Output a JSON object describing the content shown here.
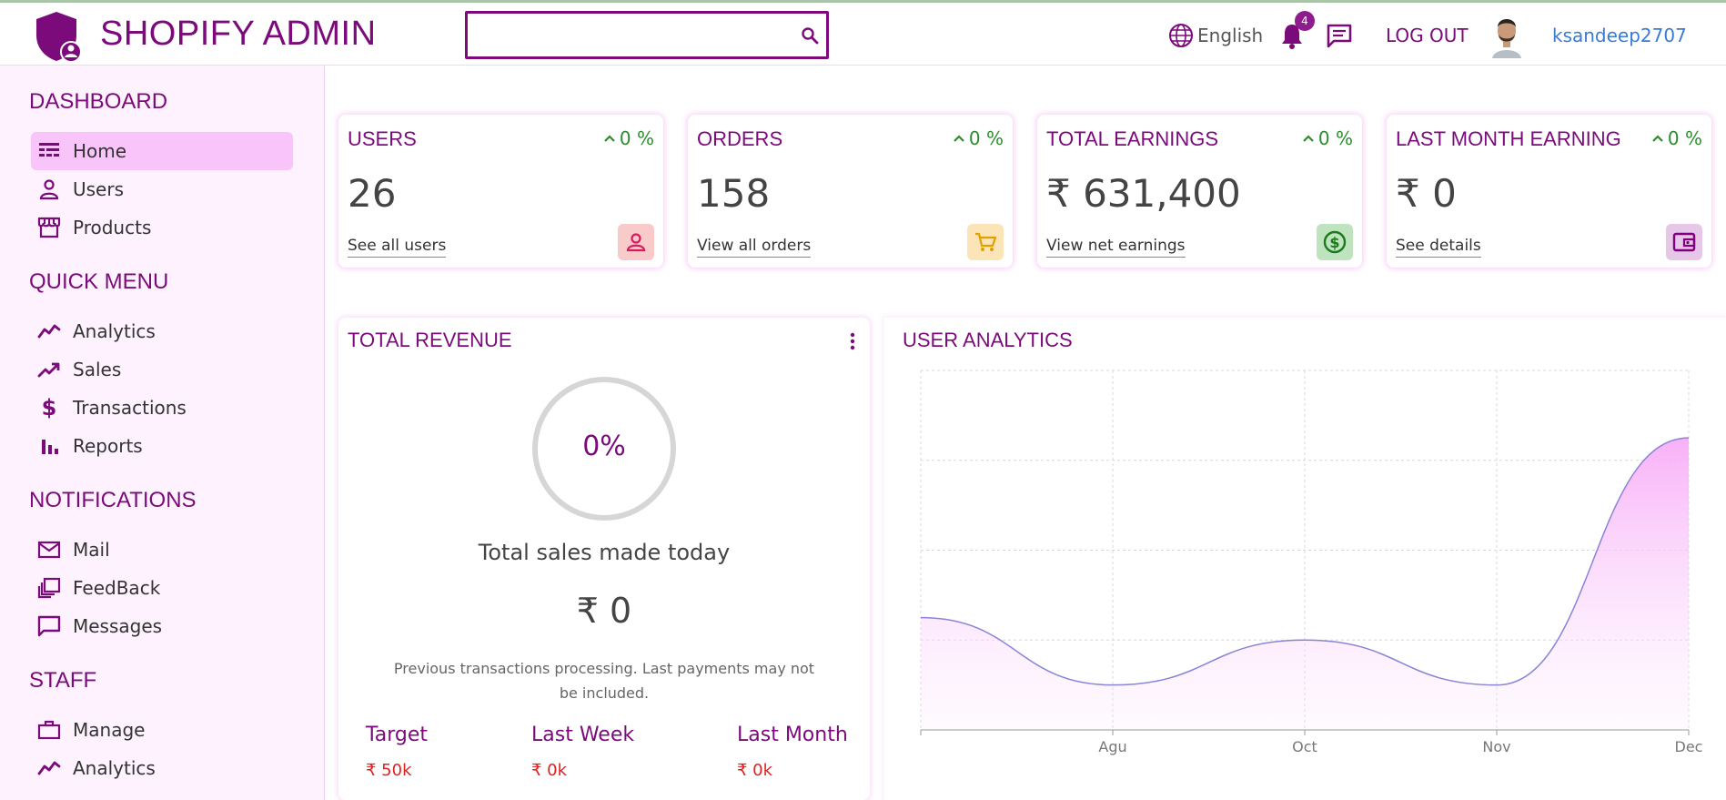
{
  "header": {
    "brand": "SHOPIFY ADMIN",
    "search_placeholder": "",
    "language": "English",
    "notification_count": "4",
    "logout_label": "LOG OUT",
    "username": "ksandeep2707"
  },
  "sidebar": {
    "sections": [
      {
        "title": "DASHBOARD",
        "items": [
          {
            "label": "Home",
            "icon": "dashboard-icon",
            "active": true
          },
          {
            "label": "Users",
            "icon": "person-icon"
          },
          {
            "label": "Products",
            "icon": "store-icon"
          }
        ]
      },
      {
        "title": "QUICK MENU",
        "items": [
          {
            "label": "Analytics",
            "icon": "line-chart-icon"
          },
          {
            "label": "Sales",
            "icon": "trending-up-icon"
          },
          {
            "label": "Transactions",
            "icon": "dollar-icon"
          },
          {
            "label": "Reports",
            "icon": "bar-chart-icon"
          }
        ]
      },
      {
        "title": "NOTIFICATIONS",
        "items": [
          {
            "label": "Mail",
            "icon": "mail-icon"
          },
          {
            "label": "FeedBack",
            "icon": "feedback-icon"
          },
          {
            "label": "Messages",
            "icon": "message-icon"
          }
        ]
      },
      {
        "title": "STAFF",
        "items": [
          {
            "label": "Manage",
            "icon": "briefcase-icon"
          },
          {
            "label": "Analytics",
            "icon": "line-chart-icon"
          }
        ]
      }
    ]
  },
  "cards": [
    {
      "title": "USERS",
      "pct": "0 %",
      "value": "26",
      "link": "See all users",
      "icon": "person-icon",
      "icon_color": "#d81b60",
      "icon_bg": "#f9caca"
    },
    {
      "title": "ORDERS",
      "pct": "0 %",
      "value": "158",
      "link": "View all orders",
      "icon": "cart-icon",
      "icon_color": "#e0a000",
      "icon_bg": "#fbe4b8"
    },
    {
      "title": "TOTAL EARNINGS",
      "pct": "0 %",
      "value": "₹ 631,400",
      "link": "View net earnings",
      "icon": "dollar-circle-icon",
      "icon_color": "#1b7a1b",
      "icon_bg": "#bfe3bf"
    },
    {
      "title": "LAST MONTH EARNING",
      "pct": "0 %",
      "value": "₹ 0",
      "link": "See details",
      "icon": "wallet-icon",
      "icon_color": "#800080",
      "icon_bg": "#e7c7e7"
    }
  ],
  "revenue": {
    "title": "TOTAL REVENUE",
    "progress_value": 0,
    "progress_label": "0%",
    "subtitle": "Total sales made today",
    "amount": "₹ 0",
    "note": "Previous transactions processing. Last payments may not be included.",
    "stats": [
      {
        "label": "Target",
        "value": "₹ 50k"
      },
      {
        "label": "Last Week",
        "value": "₹ 0k"
      },
      {
        "label": "Last Month",
        "value": "₹ 0k"
      }
    ]
  },
  "analytics": {
    "title": "USER ANALYTICS"
  },
  "chart_data": {
    "type": "area",
    "categories": [
      "",
      "Agu",
      "Oct",
      "Nov",
      "Dec"
    ],
    "series": [
      {
        "values": [
          125,
          50,
          100,
          50,
          325
        ]
      }
    ],
    "ylim": [
      0,
      400
    ],
    "grid": true,
    "color": "#8884d8",
    "fill": "#f9c4f9"
  }
}
